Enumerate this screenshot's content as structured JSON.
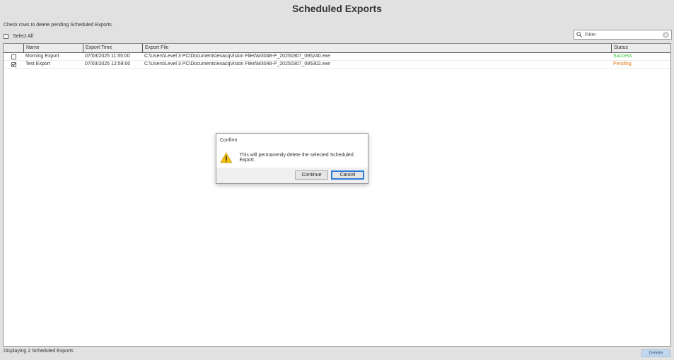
{
  "page": {
    "title": "Scheduled Exports",
    "instructions": "Check rows to delete pending Scheduled Exports.",
    "select_all_label": "Select All"
  },
  "filter": {
    "placeholder": "Filter",
    "value": ""
  },
  "table": {
    "columns": [
      "Name",
      "Export Time",
      "Export File",
      "Status"
    ],
    "rows": [
      {
        "checked": false,
        "name": "Morning Export",
        "export_time": "07/03/2025 11:55:00",
        "export_file": "C:\\Users\\Level 3 PC\\Documents\\exacqVision Files\\M3048-P_20250307_095240.exe",
        "status": "Success"
      },
      {
        "checked": true,
        "name": "Test Export",
        "export_time": "07/03/2025 12:59:00",
        "export_file": "C:\\Users\\Level 3 PC\\Documents\\exacqVision Files\\M3048-P_20250307_095302.exe",
        "status": "Pending"
      }
    ]
  },
  "footer": {
    "status_text": "Displaying 2 Scheduled Exports",
    "delete_label": "Delete"
  },
  "dialog": {
    "title": "Confirm",
    "message": "This will permanently delete the selected Scheduled Export.",
    "icon": "warning-icon",
    "continue_label": "Continue",
    "cancel_label": "Cancel"
  },
  "colors": {
    "status_success": "#2ebd2e",
    "status_pending": "#e67a16",
    "delete_button": "#c2d8ee",
    "focus_border": "#2f7cd6"
  }
}
